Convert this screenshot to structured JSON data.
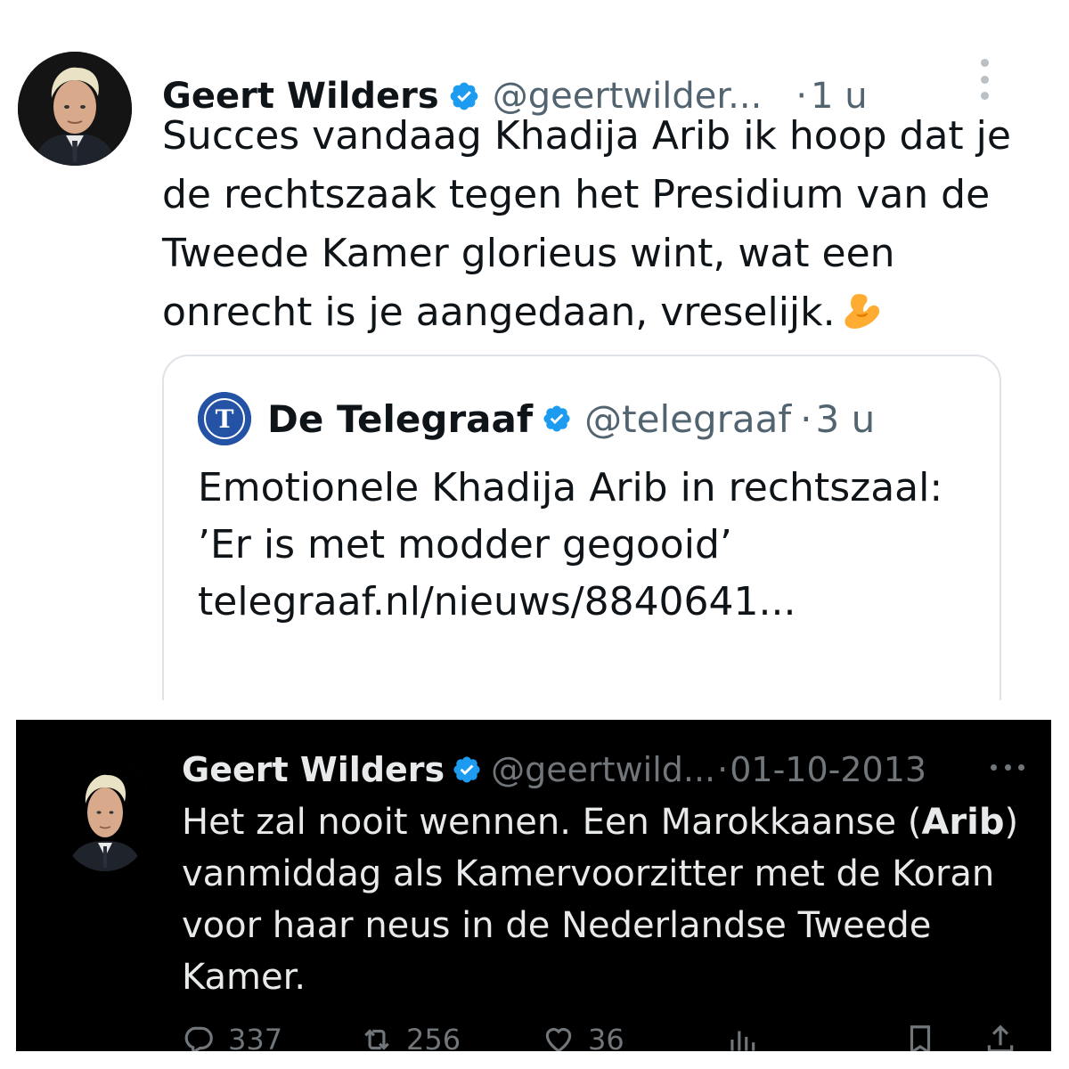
{
  "top_tweet": {
    "author_name": "Geert Wilders",
    "handle": "@geertwilder...",
    "separator": "·",
    "time": "1 u",
    "text": "Succes vandaag Khadija Arib ik hoop dat je de rechtszaak tegen het Presidium van de Tweede Kamer glorieus wint, wat een onrecht is je aangedaan, vreselijk.",
    "quoted": {
      "author_name": "De Telegraaf",
      "handle": "@telegraaf",
      "separator": "·",
      "time": "3 u",
      "text": "Emotionele Khadija Arib in rechtszaal: ’Er is met modder gegooid’ telegraaf.nl/nieuws/8840641..."
    }
  },
  "bottom_tweet": {
    "author_name": "Geert Wilders",
    "handle": "@geertwild...",
    "separator": "·",
    "time": "01-10-2013",
    "text_before": "Het zal nooit wennen. Een Marokkaanse (",
    "text_bold": "Arib",
    "text_after": ") vanmiddag als Kamervoorzitter met de Koran voor haar neus in de Nederlandse Tweede Kamer.",
    "actions": {
      "replies": "337",
      "retweets": "256",
      "likes": "36"
    }
  },
  "colors": {
    "verified_blue": "#1d9bf0",
    "telegraaf_blue": "#2453a6",
    "light_text": "#0f1419",
    "light_secondary": "#536471",
    "dark_text": "#e7e9ea",
    "dark_secondary": "#71767b"
  },
  "icons": [
    "verified-badge-icon",
    "more-options-icon",
    "flexed-biceps-emoji",
    "telegraaf-logo",
    "reply-icon",
    "retweet-icon",
    "like-icon",
    "views-icon",
    "bookmark-icon",
    "share-icon"
  ]
}
